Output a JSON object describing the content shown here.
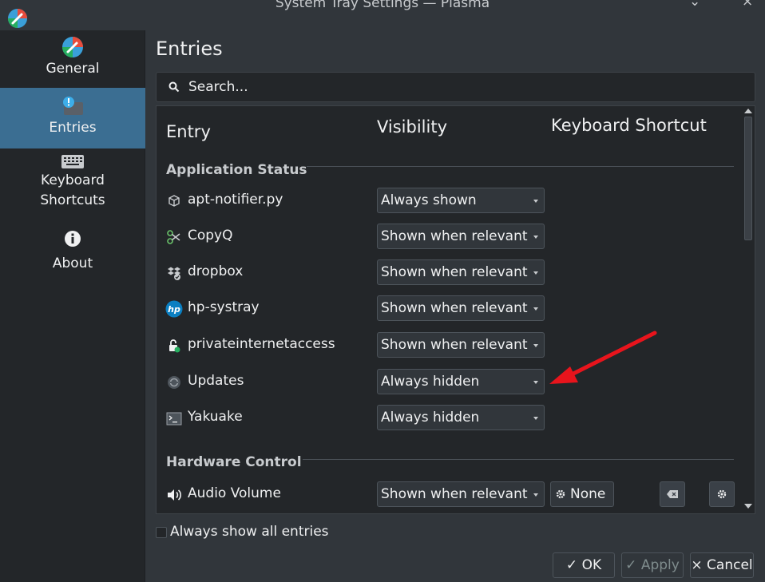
{
  "window": {
    "title": "System Tray Settings — Plasma",
    "controls": [
      "⌄",
      "^",
      "⨯"
    ]
  },
  "sidebar": {
    "items": [
      {
        "label": "General",
        "icon": "plasma-palette-icon",
        "active": false
      },
      {
        "label": "Entries",
        "icon": "notification-entries-icon",
        "active": true
      },
      {
        "label": "Keyboard\nShortcuts",
        "icon": "keyboard-icon",
        "active": false
      },
      {
        "label": "About",
        "icon": "info-icon",
        "active": false
      }
    ]
  },
  "main": {
    "heading": "Entries",
    "search": {
      "placeholder": "Search..."
    },
    "columns": {
      "entry": "Entry",
      "visibility": "Visibility",
      "shortcut": "Keyboard Shortcut"
    },
    "sections": [
      {
        "title": "Application Status",
        "rows": [
          {
            "name": "apt-notifier.py",
            "icon": "package-icon",
            "visibility": "Always shown"
          },
          {
            "name": "CopyQ",
            "icon": "scissors-icon",
            "visibility": "Shown when relevant"
          },
          {
            "name": "dropbox",
            "icon": "dropbox-icon",
            "visibility": "Shown when relevant"
          },
          {
            "name": "hp-systray",
            "icon": "hp-logo-icon",
            "visibility": "Shown when relevant"
          },
          {
            "name": "privateinternetaccess",
            "icon": "lock-icon",
            "visibility": "Shown when relevant"
          },
          {
            "name": "Updates",
            "icon": "updates-icon",
            "visibility": "Always hidden"
          },
          {
            "name": "Yakuake",
            "icon": "terminal-icon",
            "visibility": "Always hidden"
          }
        ]
      },
      {
        "title": "Hardware Control",
        "rows": [
          {
            "name": "Audio Volume",
            "icon": "speaker-icon",
            "visibility": "Shown when relevant",
            "shortcut": "None"
          }
        ]
      }
    ],
    "always_show_all": {
      "label": "Always show all entries",
      "checked": false
    }
  },
  "buttons": {
    "ok": "OK",
    "apply": "Apply",
    "cancel": "Cancel"
  },
  "colors": {
    "accent": "#3b6e92",
    "annotation_arrow": "#e8141c",
    "background": "#31363b",
    "panel": "#232629"
  }
}
